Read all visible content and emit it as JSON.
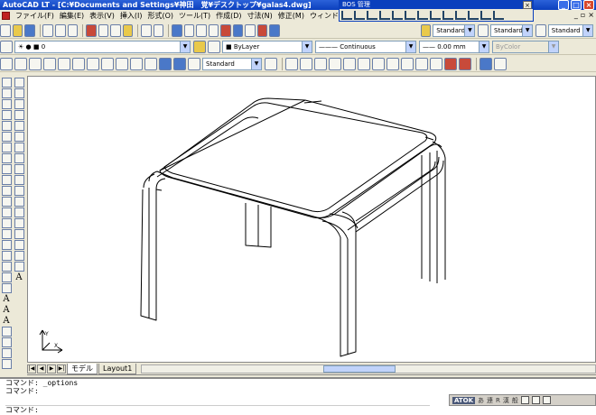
{
  "window": {
    "title": "AutoCAD LT - [C:¥Documents and Settings¥神田　覚¥デスクトップ¥galas4.dwg]"
  },
  "menubar": {
    "items": [
      "ファイル(F)",
      "編集(E)",
      "表示(V)",
      "挿入(I)",
      "形式(O)",
      "ツール(T)",
      "作成(D)",
      "寸法(N)",
      "修正(M)",
      "ウィンドウ(W)"
    ]
  },
  "bos_toolbar": {
    "title": "BOS 管理"
  },
  "toolbars": {
    "text_style": "Standard",
    "dim_style": "Standard",
    "table_style": "Standard",
    "layer": "0",
    "color": "ByLayer",
    "linetype": "Continuous",
    "lineweight": "0.00 mm",
    "plot_style": "ByColor",
    "dim_style_2": "Standard"
  },
  "tabs": {
    "items": [
      {
        "label": "モデル",
        "active": true
      },
      {
        "label": "Layout1",
        "active": false
      }
    ]
  },
  "command": {
    "lines": [
      "コマンド: _options",
      "コマンド:"
    ],
    "prompt": "コマンド:"
  },
  "ime": {
    "name": "ATOK",
    "modes": [
      "あ",
      "連",
      "R",
      "漢",
      "般"
    ]
  },
  "colors": {
    "title_bar": "#0a3fbd",
    "face": "#ece9d8",
    "canvas": "#ffffff"
  }
}
